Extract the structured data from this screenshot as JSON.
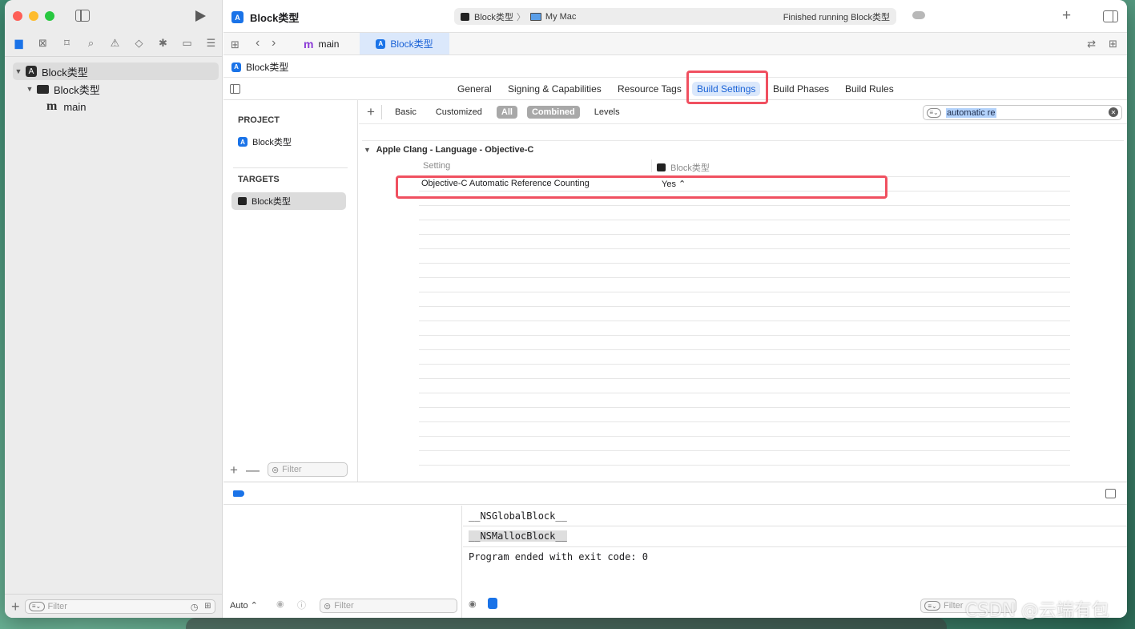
{
  "window": {
    "project_title": "Block类型",
    "scheme_target": "Block类型",
    "scheme_separator": "〉",
    "scheme_device": "My Mac",
    "status": "Finished running Block类型"
  },
  "navigator": {
    "icons": [
      "folder-icon",
      "source-control-icon",
      "bookmark-icon",
      "find-icon",
      "issue-icon",
      "test-icon",
      "debug-icon",
      "breakpoint-icon",
      "report-icon"
    ],
    "tree": [
      {
        "label": "Block类型",
        "kind": "project"
      },
      {
        "label": "Block类型",
        "kind": "folder"
      },
      {
        "label": "main",
        "kind": "file"
      }
    ],
    "filter_placeholder": "Filter"
  },
  "tabbar": {
    "tabs": [
      {
        "label": "main",
        "icon": "m"
      },
      {
        "label": "Block类型",
        "icon": "app"
      }
    ]
  },
  "breadcrumb": "Block类型",
  "editor_tabs": [
    "General",
    "Signing & Capabilities",
    "Resource Tags",
    "Build Settings",
    "Build Phases",
    "Build Rules"
  ],
  "targets_panel": {
    "project_header": "PROJECT",
    "project_item": "Block类型",
    "targets_header": "TARGETS",
    "target_item": "Block类型",
    "filter_placeholder": "Filter"
  },
  "build_settings": {
    "filters": [
      "Basic",
      "Customized",
      "All",
      "Combined",
      "Levels"
    ],
    "active_filters": [
      "All",
      "Combined"
    ],
    "search_value": "automatic re",
    "group_title": "Apple Clang - Language - Objective-C",
    "column_setting": "Setting",
    "column_target": "Block类型",
    "rows": [
      {
        "setting": "Objective-C Automatic Reference Counting",
        "value": "Yes ⌃"
      }
    ]
  },
  "debug": {
    "console_lines": [
      "__NSGlobalBlock__",
      "__NSMallocBlock__",
      "Program ended with exit code: 0"
    ],
    "auto_label": "Auto ⌃",
    "filter_placeholder": "Filter",
    "console_filter_placeholder": "Filter"
  },
  "watermark": "CSDN @云端有包",
  "colors": {
    "accent": "#1a73e8",
    "highlight": "#f05060",
    "tab_active_bg": "#dbe8fb"
  }
}
